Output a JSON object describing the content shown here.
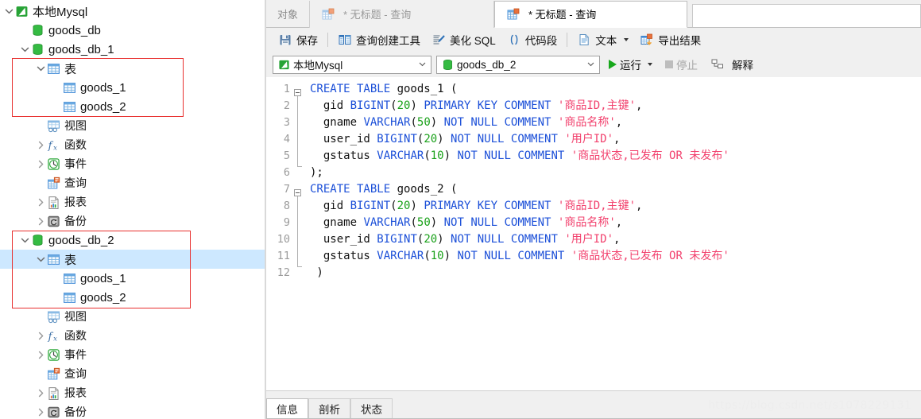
{
  "sidebar": {
    "items": [
      {
        "id": "conn-local-mysql",
        "label": "本地Mysql",
        "icon": "mysql-connection-icon",
        "depth": 0,
        "twisty": "expanded",
        "selected": false,
        "size": "big"
      },
      {
        "id": "db-goods-db",
        "label": "goods_db",
        "icon": "database-icon",
        "depth": 1,
        "twisty": "none",
        "selected": false,
        "size": "big"
      },
      {
        "id": "db-goods-db-1",
        "label": "goods_db_1",
        "icon": "database-icon",
        "depth": 1,
        "twisty": "expanded",
        "selected": false,
        "size": "big"
      },
      {
        "id": "db1-tables",
        "label": "表",
        "icon": "table-folder-icon",
        "depth": 2,
        "twisty": "expanded",
        "selected": false,
        "size": "big"
      },
      {
        "id": "db1-table-goods-1",
        "label": "goods_1",
        "icon": "table-icon",
        "depth": 3,
        "twisty": "none",
        "selected": false,
        "size": "big"
      },
      {
        "id": "db1-table-goods-2",
        "label": "goods_2",
        "icon": "table-icon",
        "depth": 3,
        "twisty": "none",
        "selected": false,
        "size": "big"
      },
      {
        "id": "db1-views",
        "label": "视图",
        "icon": "view-icon",
        "depth": 2,
        "twisty": "none",
        "selected": false,
        "size": "norm"
      },
      {
        "id": "db1-functions",
        "label": "函数",
        "icon": "function-icon",
        "depth": 2,
        "twisty": "collapsed",
        "selected": false,
        "size": "norm"
      },
      {
        "id": "db1-events",
        "label": "事件",
        "icon": "event-clock-icon",
        "depth": 2,
        "twisty": "collapsed",
        "selected": false,
        "size": "norm"
      },
      {
        "id": "db1-queries",
        "label": "查询",
        "icon": "query-icon",
        "depth": 2,
        "twisty": "none",
        "selected": false,
        "size": "norm"
      },
      {
        "id": "db1-reports",
        "label": "报表",
        "icon": "report-icon",
        "depth": 2,
        "twisty": "collapsed",
        "selected": false,
        "size": "norm"
      },
      {
        "id": "db1-backups",
        "label": "备份",
        "icon": "backup-icon",
        "depth": 2,
        "twisty": "collapsed",
        "selected": false,
        "size": "norm"
      },
      {
        "id": "db-goods-db-2",
        "label": "goods_db_2",
        "icon": "database-icon",
        "depth": 1,
        "twisty": "expanded",
        "selected": false,
        "size": "big"
      },
      {
        "id": "db2-tables",
        "label": "表",
        "icon": "table-folder-icon",
        "depth": 2,
        "twisty": "expanded",
        "selected": true,
        "size": "big"
      },
      {
        "id": "db2-table-goods-1",
        "label": "goods_1",
        "icon": "table-icon",
        "depth": 3,
        "twisty": "none",
        "selected": false,
        "size": "big"
      },
      {
        "id": "db2-table-goods-2",
        "label": "goods_2",
        "icon": "table-icon",
        "depth": 3,
        "twisty": "none",
        "selected": false,
        "size": "big"
      },
      {
        "id": "db2-views",
        "label": "视图",
        "icon": "view-icon",
        "depth": 2,
        "twisty": "none",
        "selected": false,
        "size": "norm"
      },
      {
        "id": "db2-functions",
        "label": "函数",
        "icon": "function-icon",
        "depth": 2,
        "twisty": "collapsed",
        "selected": false,
        "size": "norm"
      },
      {
        "id": "db2-events",
        "label": "事件",
        "icon": "event-clock-icon",
        "depth": 2,
        "twisty": "collapsed",
        "selected": false,
        "size": "norm"
      },
      {
        "id": "db2-queries",
        "label": "查询",
        "icon": "query-icon",
        "depth": 2,
        "twisty": "none",
        "selected": false,
        "size": "norm"
      },
      {
        "id": "db2-reports",
        "label": "报表",
        "icon": "report-icon",
        "depth": 2,
        "twisty": "collapsed",
        "selected": false,
        "size": "norm"
      },
      {
        "id": "db2-backups",
        "label": "备份",
        "icon": "backup-icon",
        "depth": 2,
        "twisty": "collapsed",
        "selected": false,
        "size": "norm"
      }
    ],
    "annotation_color": "#e8302f"
  },
  "tabs": {
    "objects_label": "对象",
    "inactive_tab": {
      "label": "* 无标题 - 查询",
      "icon": "query-tab-icon"
    },
    "active_tab": {
      "label": "* 无标题 - 查询",
      "icon": "query-tab-icon"
    }
  },
  "toolbar": {
    "save_label": "保存",
    "query_builder_label": "查询创建工具",
    "beautify_sql_label": "美化 SQL",
    "code_snippet_label": "代码段",
    "text_label": "文本",
    "export_result_label": "导出结果"
  },
  "connbar": {
    "connection_value": "本地Mysql",
    "database_value": "goods_db_2",
    "run_label": "运行",
    "stop_label": "停止",
    "explain_label": "解释"
  },
  "editor": {
    "line_numbers": [
      "1",
      "2",
      "3",
      "4",
      "5",
      "6",
      "7",
      "8",
      "9",
      "10",
      "11",
      "12"
    ],
    "lines": [
      [
        {
          "t": "CREATE TABLE ",
          "c": "kw"
        },
        {
          "t": "goods_1 (",
          "c": "pl"
        }
      ],
      [
        {
          "t": "  gid ",
          "c": "pl"
        },
        {
          "t": "BIGINT",
          "c": "kw"
        },
        {
          "t": "(",
          "c": "pl"
        },
        {
          "t": "20",
          "c": "num"
        },
        {
          "t": ") ",
          "c": "pl"
        },
        {
          "t": "PRIMARY KEY COMMENT ",
          "c": "kw"
        },
        {
          "t": "'商品ID,主键'",
          "c": "str"
        },
        {
          "t": ",",
          "c": "pl"
        }
      ],
      [
        {
          "t": "  gname ",
          "c": "pl"
        },
        {
          "t": "VARCHAR",
          "c": "kw"
        },
        {
          "t": "(",
          "c": "pl"
        },
        {
          "t": "50",
          "c": "num"
        },
        {
          "t": ") ",
          "c": "pl"
        },
        {
          "t": "NOT NULL COMMENT ",
          "c": "kw"
        },
        {
          "t": "'商品名称'",
          "c": "str"
        },
        {
          "t": ",",
          "c": "pl"
        }
      ],
      [
        {
          "t": "  user_id ",
          "c": "pl"
        },
        {
          "t": "BIGINT",
          "c": "kw"
        },
        {
          "t": "(",
          "c": "pl"
        },
        {
          "t": "20",
          "c": "num"
        },
        {
          "t": ") ",
          "c": "pl"
        },
        {
          "t": "NOT NULL COMMENT ",
          "c": "kw"
        },
        {
          "t": "'用户ID'",
          "c": "str"
        },
        {
          "t": ",",
          "c": "pl"
        }
      ],
      [
        {
          "t": "  gstatus ",
          "c": "pl"
        },
        {
          "t": "VARCHAR",
          "c": "kw"
        },
        {
          "t": "(",
          "c": "pl"
        },
        {
          "t": "10",
          "c": "num"
        },
        {
          "t": ") ",
          "c": "pl"
        },
        {
          "t": "NOT NULL COMMENT ",
          "c": "kw"
        },
        {
          "t": "'商品状态,已发布 OR 未发布'",
          "c": "str"
        }
      ],
      [
        {
          "t": ");",
          "c": "pl"
        }
      ],
      [
        {
          "t": "CREATE TABLE ",
          "c": "kw"
        },
        {
          "t": "goods_2 (",
          "c": "pl"
        }
      ],
      [
        {
          "t": "  gid ",
          "c": "pl"
        },
        {
          "t": "BIGINT",
          "c": "kw"
        },
        {
          "t": "(",
          "c": "pl"
        },
        {
          "t": "20",
          "c": "num"
        },
        {
          "t": ") ",
          "c": "pl"
        },
        {
          "t": "PRIMARY KEY COMMENT ",
          "c": "kw"
        },
        {
          "t": "'商品ID,主键'",
          "c": "str"
        },
        {
          "t": ",",
          "c": "pl"
        }
      ],
      [
        {
          "t": "  gname ",
          "c": "pl"
        },
        {
          "t": "VARCHAR",
          "c": "kw"
        },
        {
          "t": "(",
          "c": "pl"
        },
        {
          "t": "50",
          "c": "num"
        },
        {
          "t": ") ",
          "c": "pl"
        },
        {
          "t": "NOT NULL COMMENT ",
          "c": "kw"
        },
        {
          "t": "'商品名称'",
          "c": "str"
        },
        {
          "t": ",",
          "c": "pl"
        }
      ],
      [
        {
          "t": "  user_id ",
          "c": "pl"
        },
        {
          "t": "BIGINT",
          "c": "kw"
        },
        {
          "t": "(",
          "c": "pl"
        },
        {
          "t": "20",
          "c": "num"
        },
        {
          "t": ") ",
          "c": "pl"
        },
        {
          "t": "NOT NULL COMMENT ",
          "c": "kw"
        },
        {
          "t": "'用户ID'",
          "c": "str"
        },
        {
          "t": ",",
          "c": "pl"
        }
      ],
      [
        {
          "t": "  gstatus ",
          "c": "pl"
        },
        {
          "t": "VARCHAR",
          "c": "kw"
        },
        {
          "t": "(",
          "c": "pl"
        },
        {
          "t": "10",
          "c": "num"
        },
        {
          "t": ") ",
          "c": "pl"
        },
        {
          "t": "NOT NULL COMMENT ",
          "c": "kw"
        },
        {
          "t": "'商品状态,已发布 OR 未发布'",
          "c": "str"
        }
      ],
      [
        {
          "t": " )",
          "c": "pl"
        }
      ]
    ],
    "colors": {
      "keyword": "#1b4fd8",
      "number": "#1aa11a",
      "string": "#f2426e",
      "plain": "#111111"
    }
  },
  "bottom": {
    "tabs": [
      {
        "label": "信息",
        "active": true
      },
      {
        "label": "剖析",
        "active": false
      },
      {
        "label": "状态",
        "active": false
      }
    ],
    "watermark": "https://blog.csdn.net/s1078229131"
  }
}
